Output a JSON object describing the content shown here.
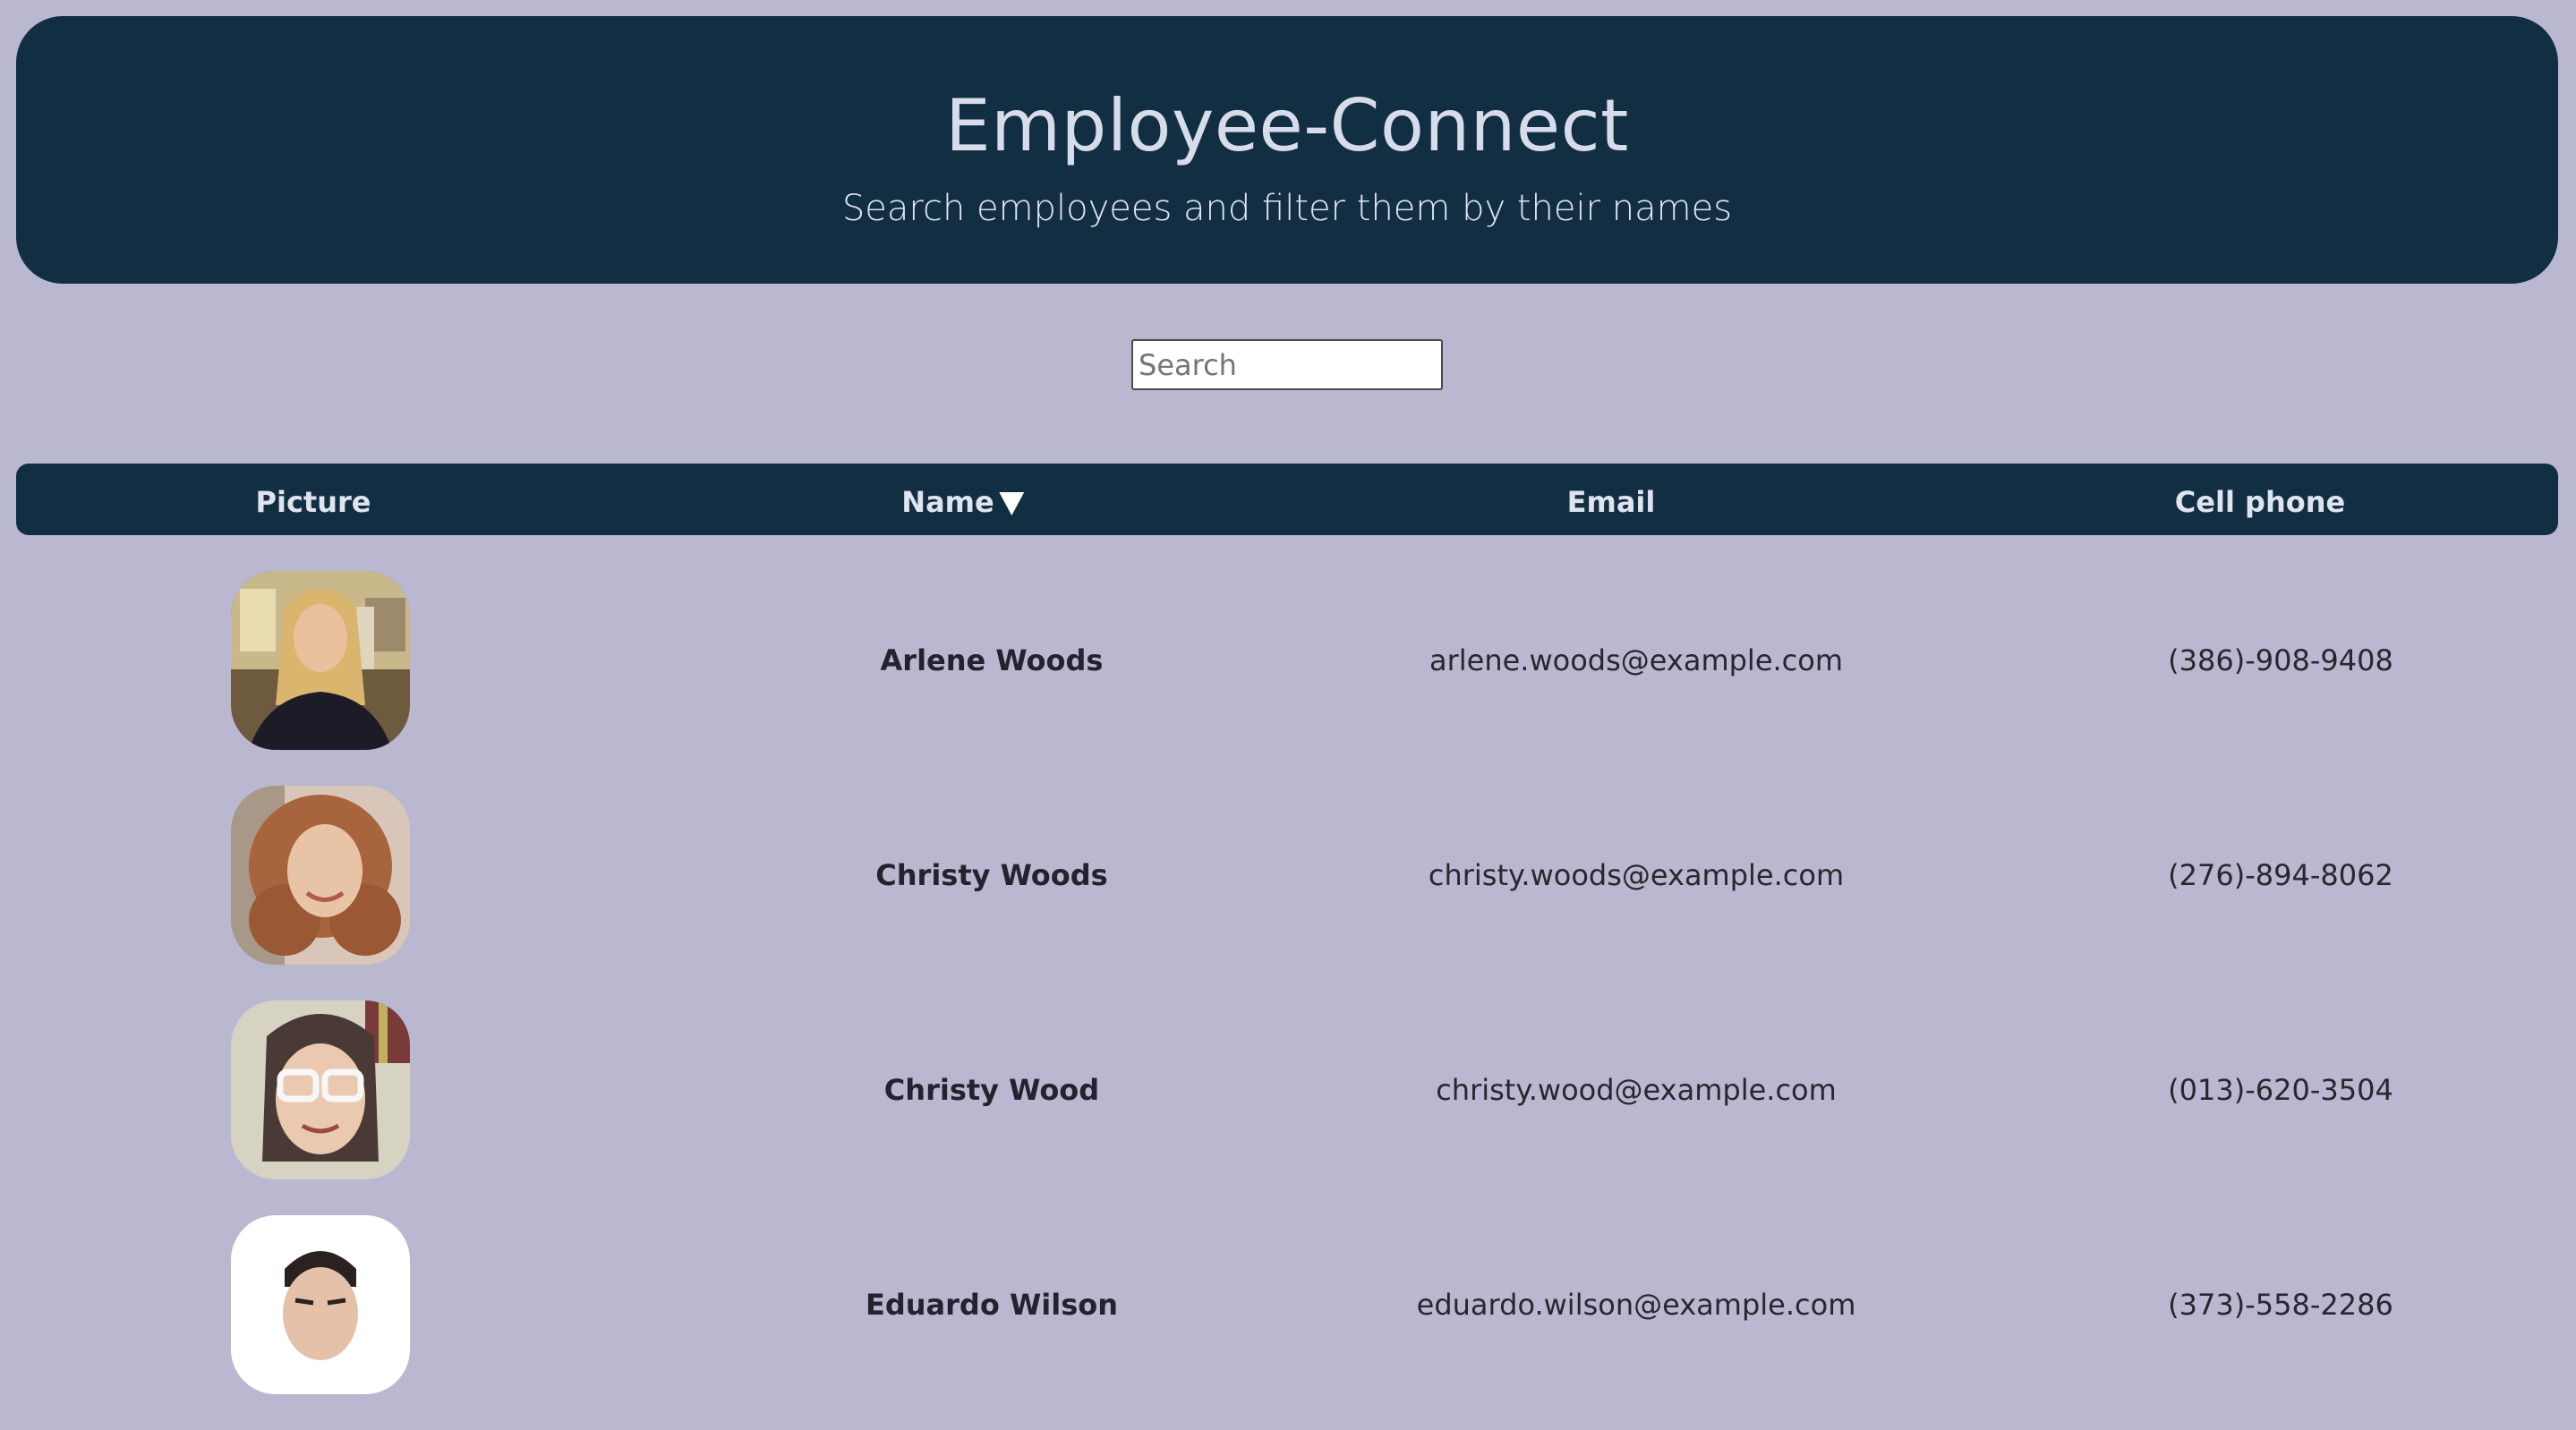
{
  "header": {
    "title": "Employee-Connect",
    "subtitle": "Search employees and filter them by their names"
  },
  "search": {
    "placeholder": "Search",
    "value": ""
  },
  "table": {
    "columns": [
      "Picture",
      "Name",
      "Email",
      "Cell phone"
    ],
    "sort": {
      "column": "Name",
      "direction": "descending",
      "icon": "caret-down-icon"
    },
    "rows": [
      {
        "name": "Arlene Woods",
        "email": "arlene.woods@example.com",
        "phone": "(386)-908-9408"
      },
      {
        "name": "Christy Woods",
        "email": "christy.woods@example.com",
        "phone": "(276)-894-8062"
      },
      {
        "name": "Christy Wood",
        "email": "christy.wood@example.com",
        "phone": "(013)-620-3504"
      },
      {
        "name": "Eduardo Wilson",
        "email": "eduardo.wilson@example.com",
        "phone": "(373)-558-2286"
      }
    ]
  },
  "colors": {
    "background": "#b9b8d0",
    "header_bg": "#122e43",
    "header_text": "#d6dcea"
  }
}
